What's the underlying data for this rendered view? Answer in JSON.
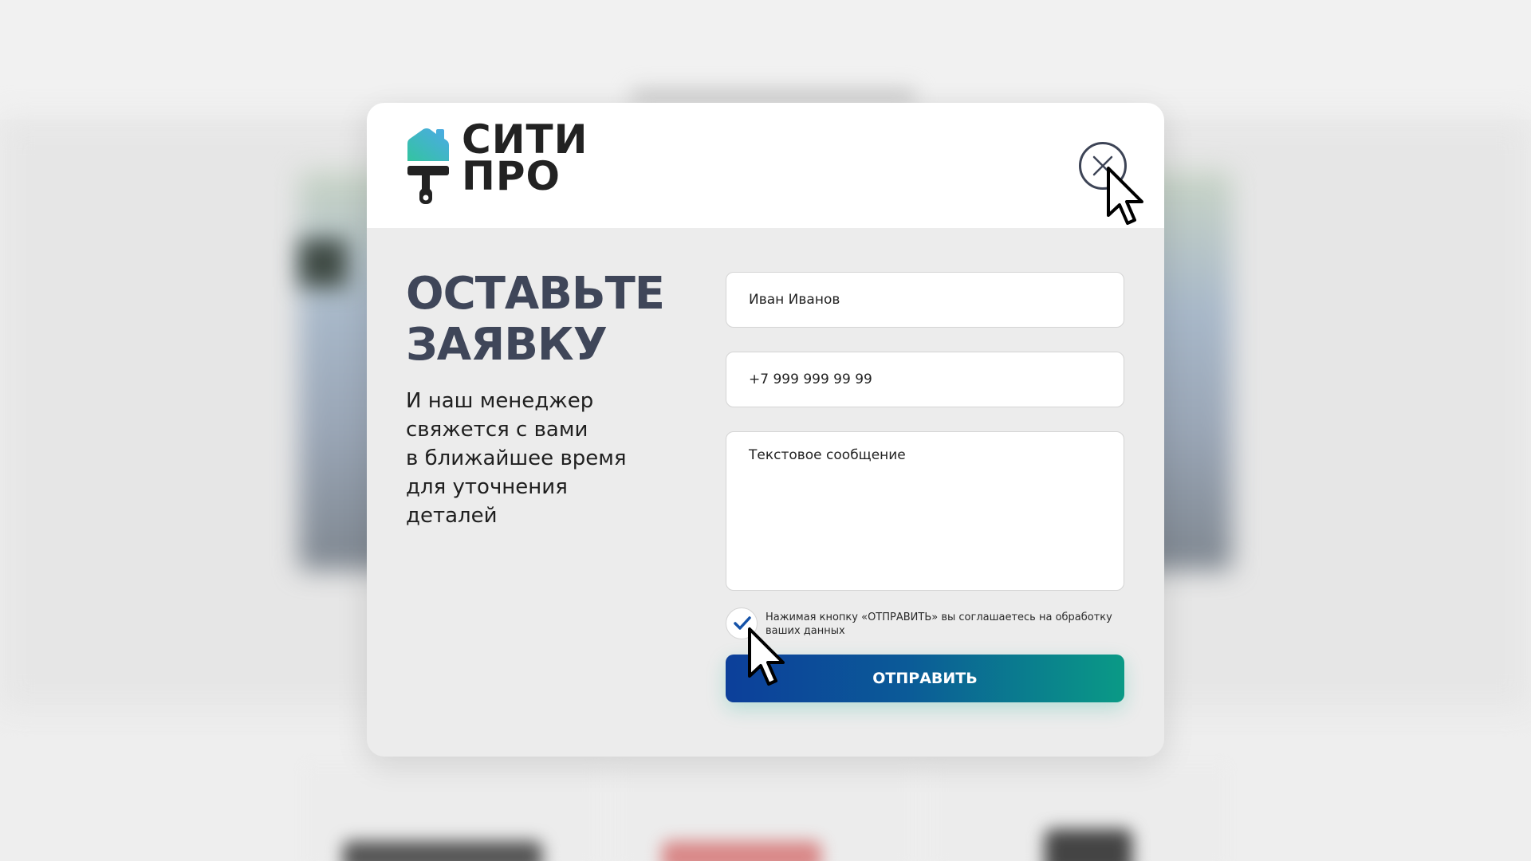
{
  "brand": {
    "line1": "СИТИ",
    "line2": "ПРО",
    "gradient_colors": [
      "#33c4a0",
      "#4da9e8"
    ],
    "text_color": "#222222"
  },
  "modal": {
    "title_line1": "ОСТАВЬТЕ",
    "title_line2": "ЗАЯВКУ",
    "subtitle_lines": [
      "И наш менеджер",
      "свяжется с вами",
      "в ближайшее время",
      "для уточнения",
      "деталей"
    ],
    "close_icon": "close-x-icon"
  },
  "form": {
    "name_placeholder": "Иван Иванов",
    "phone_placeholder": "+7 999 999 99 99",
    "message_placeholder": "Текстовое сообщение",
    "consent_checked": true,
    "consent_text": "Нажимая кнопку «ОТПРАВИТЬ» вы соглашаетесь на обработку ваших данных",
    "submit_label": "ОТПРАВИТЬ"
  },
  "colors": {
    "title": "#3f4659",
    "button_gradient": [
      "#0c3f9a",
      "#0a9a86"
    ],
    "check": "#1552a8"
  }
}
